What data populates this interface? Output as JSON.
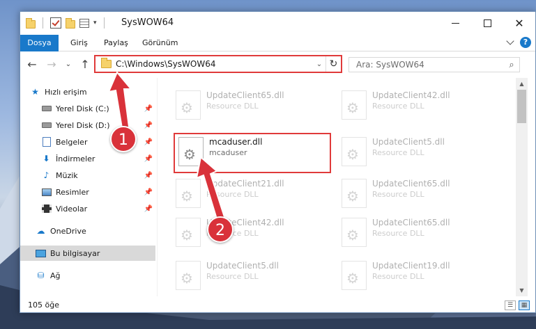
{
  "titlebar": {
    "title": "SysWOW64",
    "minimize_symbol": "—",
    "maximize_symbol": "☐",
    "close_symbol": "✕"
  },
  "ribbon": {
    "tabs": [
      {
        "label": "Dosya"
      },
      {
        "label": "Giriş"
      },
      {
        "label": "Paylaş"
      },
      {
        "label": "Görünüm"
      }
    ],
    "help_symbol": "?"
  },
  "navigation": {
    "back_symbol": "←",
    "forward_symbol": "→",
    "recent_symbol": "⌄",
    "up_symbol": "↑",
    "address": "C:\\Windows\\SysWOW64",
    "address_dropdown_symbol": "⌄",
    "refresh_symbol": "↻",
    "search_placeholder": "Ara: SysWOW64",
    "search_symbol": "⌕"
  },
  "sidebar": {
    "items": [
      {
        "label": "Hızlı erişim",
        "icon": "star-icon"
      },
      {
        "label": "Yerel Disk (C:)",
        "icon": "disk-icon"
      },
      {
        "label": "Yerel Disk (D:)",
        "icon": "disk-icon"
      },
      {
        "label": "Belgeler",
        "icon": "documents-icon"
      },
      {
        "label": "İndirmeler",
        "icon": "downloads-icon"
      },
      {
        "label": "Müzik",
        "icon": "music-icon"
      },
      {
        "label": "Resimler",
        "icon": "pictures-icon"
      },
      {
        "label": "Videolar",
        "icon": "videos-icon"
      },
      {
        "label": "OneDrive",
        "icon": "onedrive-icon"
      },
      {
        "label": "Bu bilgisayar",
        "icon": "this-pc-icon"
      },
      {
        "label": "Ağ",
        "icon": "network-icon"
      }
    ],
    "pin_symbol": "📌"
  },
  "files": [
    {
      "name": "UpdateClient65.dll",
      "desc": "Resource DLL"
    },
    {
      "name": "UpdateClient42.dll",
      "desc": "Resource DLL"
    },
    {
      "name": "mcaduser.dll",
      "desc": "mcaduser"
    },
    {
      "name": "UpdateClient5.dll",
      "desc": "Resource DLL"
    },
    {
      "name": "UpdateClient21.dll",
      "desc": "Resource DLL"
    },
    {
      "name": "UpdateClient65.dll",
      "desc": "Resource DLL"
    },
    {
      "name": "UpdateClient42.dll",
      "desc": "Resource DLL"
    },
    {
      "name": "UpdateClient65.dll",
      "desc": "Resource DLL"
    },
    {
      "name": "UpdateClient5.dll",
      "desc": "Resource DLL"
    },
    {
      "name": "UpdateClient19.dll",
      "desc": "Resource DLL"
    }
  ],
  "status": {
    "item_count": "105 öğe"
  },
  "callouts": {
    "step1": "1",
    "step2": "2",
    "color": "#d9323a"
  }
}
